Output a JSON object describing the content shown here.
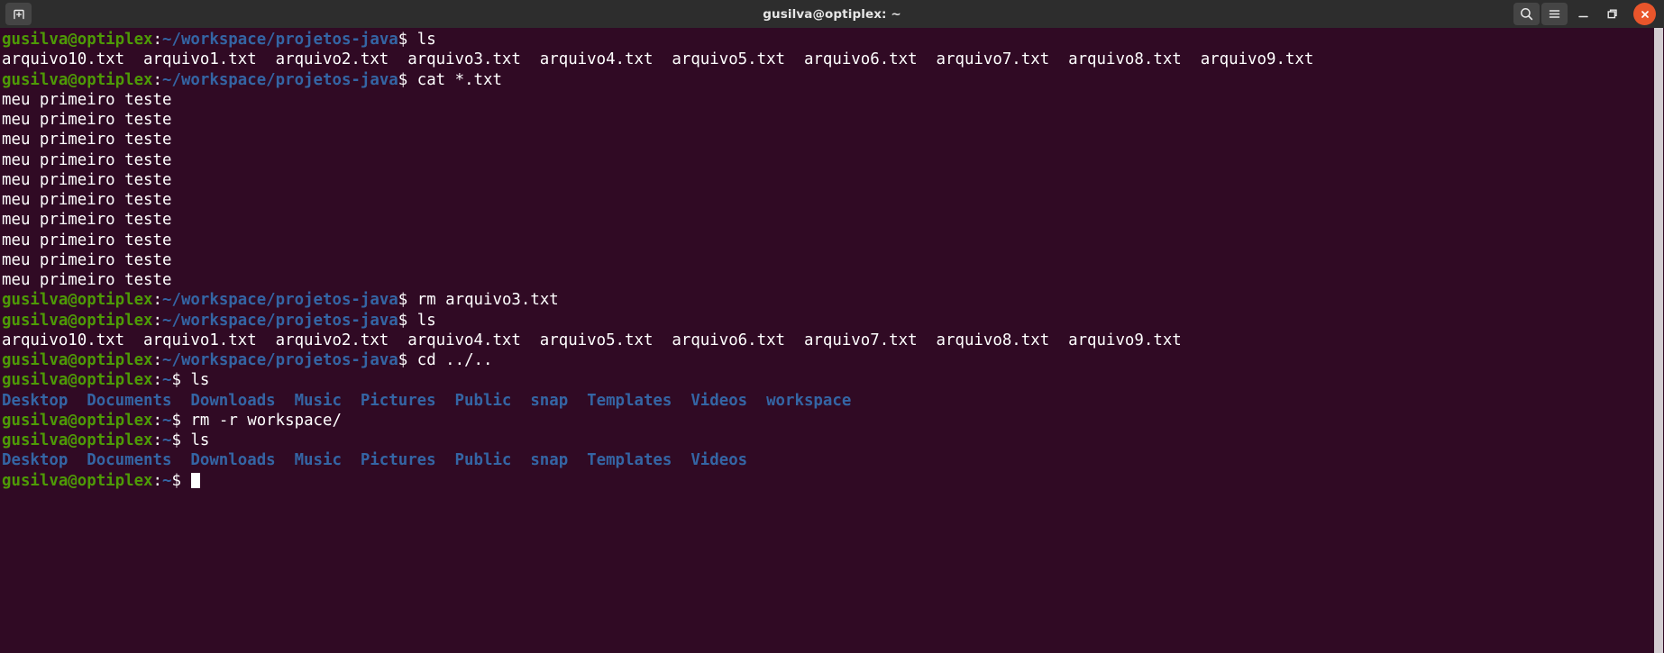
{
  "window": {
    "title": "gusilva@optiplex: ~",
    "titlebar_bg": "#2d2d2d",
    "close_color": "#e9552b",
    "new_tab_label": "new-tab",
    "search_label": "search",
    "menu_label": "menu",
    "minimize_label": "minimize",
    "maximize_label": "maximize",
    "close_label": "close"
  },
  "terminal": {
    "bg": "#300a24",
    "fg": "#ffffff",
    "user_color": "#4e9a06",
    "path_color": "#3465a4",
    "dir_color": "#3465a4",
    "user_host": "gusilva@optiplex",
    "colon": ":",
    "path_project": "~/workspace/projetos-java",
    "path_home": "~",
    "dollar": "$ ",
    "commands": {
      "ls": "ls",
      "cat": "cat *.txt",
      "rm_file": "rm arquivo3.txt",
      "cd_up": "cd ../..",
      "rm_dir": "rm -r workspace/"
    },
    "files_before": "arquivo10.txt  arquivo1.txt  arquivo2.txt  arquivo3.txt  arquivo4.txt  arquivo5.txt  arquivo6.txt  arquivo7.txt  arquivo8.txt  arquivo9.txt",
    "files_after": "arquivo10.txt  arquivo1.txt  arquivo2.txt  arquivo4.txt  arquivo5.txt  arquivo6.txt  arquivo7.txt  arquivo8.txt  arquivo9.txt",
    "cat_line": "meu primeiro teste",
    "cat_line_count": 10,
    "home_dirs_with_workspace": "Desktop  Documents  Downloads  Music  Pictures  Public  snap  Templates  Videos  workspace",
    "home_dirs_after": "Desktop  Documents  Downloads  Music  Pictures  Public  snap  Templates  Videos"
  }
}
